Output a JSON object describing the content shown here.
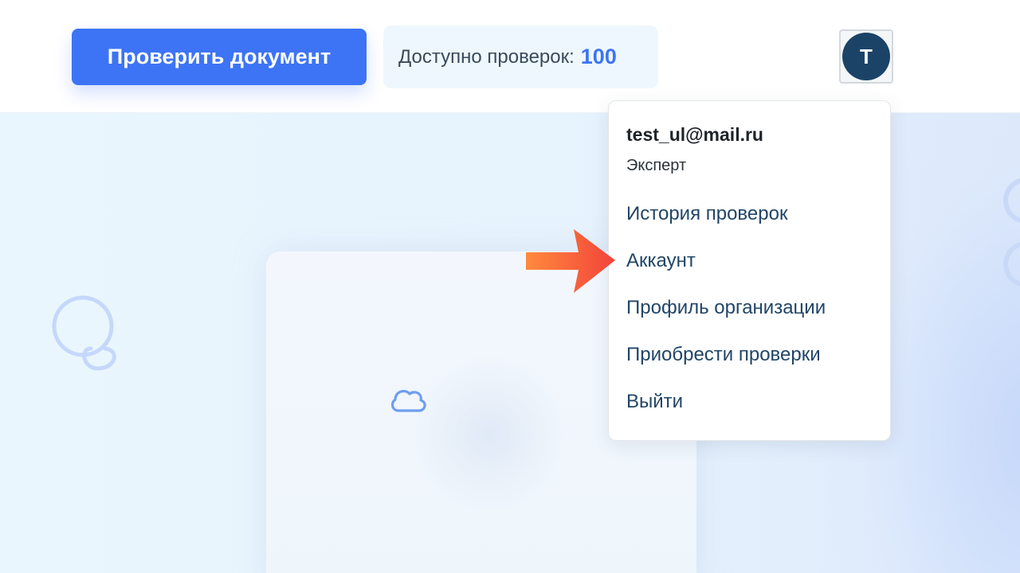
{
  "header": {
    "check_button_label": "Проверить документ",
    "checks_label": "Доступно проверок:",
    "checks_count": "100",
    "avatar_letter": "T"
  },
  "menu": {
    "email": "test_ul@mail.ru",
    "role": "Эксперт",
    "items": [
      {
        "label": "История проверок"
      },
      {
        "label": "Аккаунт"
      },
      {
        "label": "Профиль организации"
      },
      {
        "label": "Приобрести проверки"
      },
      {
        "label": "Выйти"
      }
    ]
  },
  "annotation": {
    "arrow_target": "Аккаунт",
    "arrow_color": "#f2433a"
  },
  "colors": {
    "primary": "#3d74f5",
    "avatar_bg": "#1b4368",
    "menu_item_text": "#214567"
  },
  "icons": {
    "background_card": "cloud-icon",
    "decoration": "swirl-decoration"
  }
}
